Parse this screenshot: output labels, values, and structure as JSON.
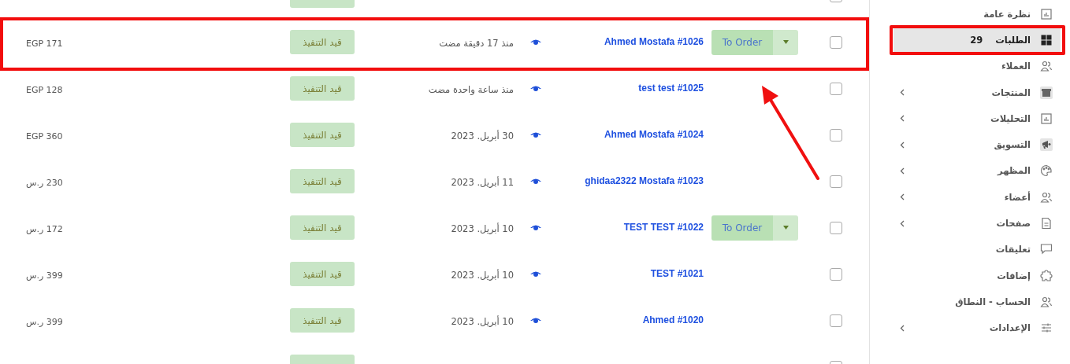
{
  "orders": [
    {
      "kind": "partial",
      "highlighted": false,
      "checked": false
    },
    {
      "kind": "order",
      "highlighted": true,
      "name": "Ahmed Mostafa #1026",
      "order_button": "To Order",
      "date": "منذ 17 دقيقة مضت",
      "status": "قيد التنفيذ",
      "total": "EGP 171",
      "checked": false
    },
    {
      "kind": "order",
      "highlighted": false,
      "name": "test test #1025",
      "date": "منذ ساعة واحدة مضت",
      "status": "قيد التنفيذ",
      "total": "EGP 128",
      "checked": false
    },
    {
      "kind": "order",
      "highlighted": false,
      "name": "Ahmed Mostafa #1024",
      "date": "30 أبريل. 2023",
      "status": "قيد التنفيذ",
      "total": "EGP 360",
      "checked": false
    },
    {
      "kind": "order",
      "highlighted": false,
      "name": "ghidaa2322 Mostafa #1023",
      "date": "11 أبريل. 2023",
      "status": "قيد التنفيذ",
      "total": "230 ر.س",
      "checked": false
    },
    {
      "kind": "order",
      "highlighted": false,
      "name": "TEST TEST #1022",
      "order_button": "To Order",
      "date": "10 أبريل. 2023",
      "status": "قيد التنفيذ",
      "total": "172 ر.س",
      "checked": false
    },
    {
      "kind": "order",
      "highlighted": false,
      "name": "TEST #1021",
      "date": "10 أبريل. 2023",
      "status": "قيد التنفيذ",
      "total": "399 ر.س",
      "checked": false
    },
    {
      "kind": "order",
      "highlighted": false,
      "name": "Ahmed #1020",
      "date": "10 أبريل. 2023",
      "status": "قيد التنفيذ",
      "total": "399 ر.س",
      "checked": false
    },
    {
      "kind": "partial",
      "highlighted": false,
      "checked": false
    }
  ],
  "sidebar": {
    "items": [
      {
        "label": "نظرة عامة",
        "selected": false,
        "expandable": false,
        "highlighted": false
      },
      {
        "label": "الطلبات",
        "count": "29",
        "selected": true,
        "expandable": false,
        "highlighted": true
      },
      {
        "label": "العملاء",
        "selected": false,
        "expandable": false,
        "highlighted": false
      },
      {
        "label": "المنتجات",
        "selected": false,
        "expandable": true,
        "highlighted": false
      },
      {
        "label": "التحليلات",
        "selected": false,
        "expandable": true,
        "highlighted": false
      },
      {
        "label": "التسويق",
        "selected": false,
        "expandable": true,
        "highlighted": false
      },
      {
        "label": "المظهر",
        "selected": false,
        "expandable": true,
        "highlighted": false
      },
      {
        "label": "أعضاء",
        "selected": false,
        "expandable": true,
        "highlighted": false
      },
      {
        "label": "صفحات",
        "selected": false,
        "expandable": true,
        "highlighted": false
      },
      {
        "label": "تعليقات",
        "selected": false,
        "expandable": false,
        "highlighted": false
      },
      {
        "label": "إضافات",
        "selected": false,
        "expandable": false,
        "highlighted": false
      },
      {
        "label": "الحساب - النطاق",
        "selected": false,
        "expandable": false,
        "highlighted": false
      },
      {
        "label": "الإعدادات",
        "selected": false,
        "expandable": true,
        "highlighted": false
      }
    ]
  }
}
